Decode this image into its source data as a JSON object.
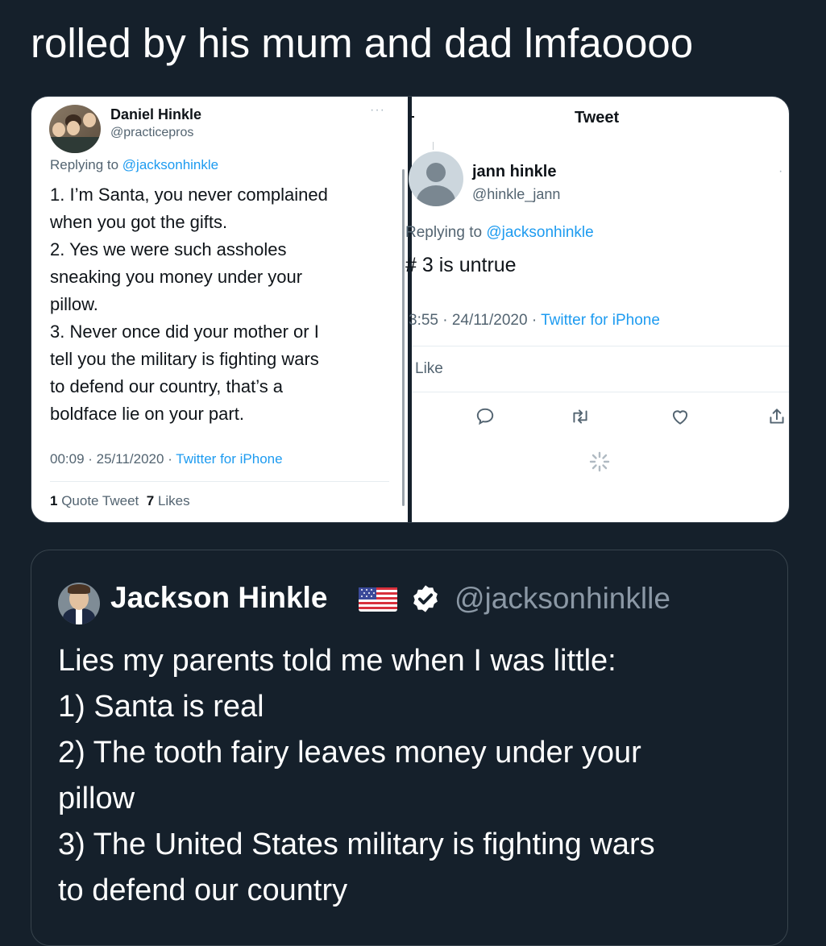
{
  "caption": "rolled by his mum and dad lmfaoooo",
  "left_tweet": {
    "author_name": "Daniel Hinkle",
    "author_handle": "@practicepros",
    "more_label": "···",
    "replying_prefix": "Replying to",
    "replying_to": "@jacksonhinkle",
    "lines": [
      "1. I’m Santa, you never complained",
      "when you got the gifts.",
      "2. Yes we were such assholes",
      "sneaking you money under your",
      "pillow.",
      "3. Never once did your mother or I",
      "tell you the military is fighting wars",
      "to defend our country, that’s a",
      "boldface lie on your part."
    ],
    "time_date": "00:09 · 25/11/2020 ·",
    "source": "Twitter for iPhone",
    "quote_count": "1",
    "quote_label": "Quote Tweet",
    "likes_count": "7",
    "likes_label": "Likes"
  },
  "right_tweet": {
    "header_title": "Tweet",
    "author_name": "jann hinkle",
    "author_handle": "@hinkle_jann",
    "replying_prefix": "Replying to",
    "replying_to": "@jacksonhinkle",
    "text": "# 3 is untrue",
    "time_date": "3:55 · 24/11/2020 ·",
    "source": "Twitter for iPhone",
    "like_label": "Like",
    "actions": [
      "reply-icon",
      "retweet-icon",
      "like-icon",
      "share-icon"
    ]
  },
  "quoted_tweet": {
    "author_name": "Jackson Hinkle",
    "author_handle": "@jacksonhinklle",
    "icons": [
      "us-flag-icon",
      "verified-badge-icon"
    ],
    "lines": [
      "Lies my parents told me when I was little:",
      "1) Santa is real",
      "2) The tooth fairy leaves money under your",
      "pillow",
      "3) The United States military is fighting wars",
      "to defend our country"
    ]
  },
  "colors": {
    "background": "#15202b",
    "link": "#1d9bf0",
    "muted": "#536471",
    "handle_dark": "#8b98a5"
  }
}
